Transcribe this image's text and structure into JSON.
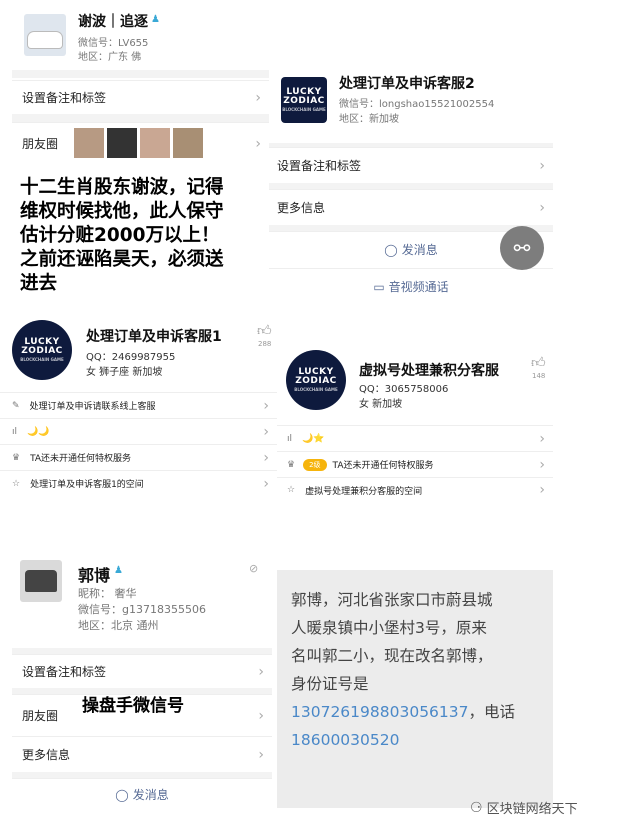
{
  "p1": {
    "name": "谢波｜追逐",
    "wechat": "微信号：LV655",
    "region": "地区：广东 佛",
    "set_note": "设置备注和标签",
    "moments": "朋友圈",
    "overlay": [
      "十二生肖股东谢波，记得",
      "维权时候找他，此人保守",
      "估计分赃2000万以上！",
      "之前还诬陷昊天，必须送",
      "进去"
    ]
  },
  "p2": {
    "name": "处理订单及申诉客服2",
    "wechat": "微信号：longshao15521002554",
    "region": "地区：新加坡",
    "set_note": "设置备注和标签",
    "more": "更多信息",
    "send": "发消息",
    "call": "音视频通话",
    "logo_line1": "LUCKY",
    "logo_line2": "ZODIAC",
    "logo_sub": "BLOCKCHAIN GAME"
  },
  "p3": {
    "name": "处理订单及申诉客服1",
    "qq": "QQ：2469987955",
    "info": "女  狮子座  新加坡",
    "likes": "288",
    "rows": [
      "处理订单及申诉请联系线上客服",
      "🌙🌙",
      "TA还未开通任何特权服务",
      "处理订单及申诉客服1的空间"
    ]
  },
  "p4": {
    "name": "虚拟号处理兼积分客服",
    "qq": "QQ：3065758006",
    "info": "女  新加坡",
    "likes": "148",
    "rows": [
      "🌙⭐",
      "TA还未开通任何特权服务",
      "虚拟号处理兼积分客服的空间"
    ],
    "badge": "2级"
  },
  "p5": {
    "name": "郭博",
    "nick": "昵称：   奢华",
    "wechat": "微信号：g13718355506",
    "region": "地区：北京  通州",
    "set_note": "设置备注和标签",
    "moments": "朋友圈",
    "more": "更多信息",
    "send": "发消息",
    "overlay": "操盘手微信号"
  },
  "p6": {
    "lines": [
      "郭博，河北省张家口市蔚县城",
      "人暖泉镇中小堡村3号，原来",
      "名叫郭二小，现在改名郭博，",
      "身份证号是"
    ],
    "id": "130726198803056137",
    "mid": "，电话",
    "phone": "18600030520"
  },
  "watermark": "区块链网络天下"
}
